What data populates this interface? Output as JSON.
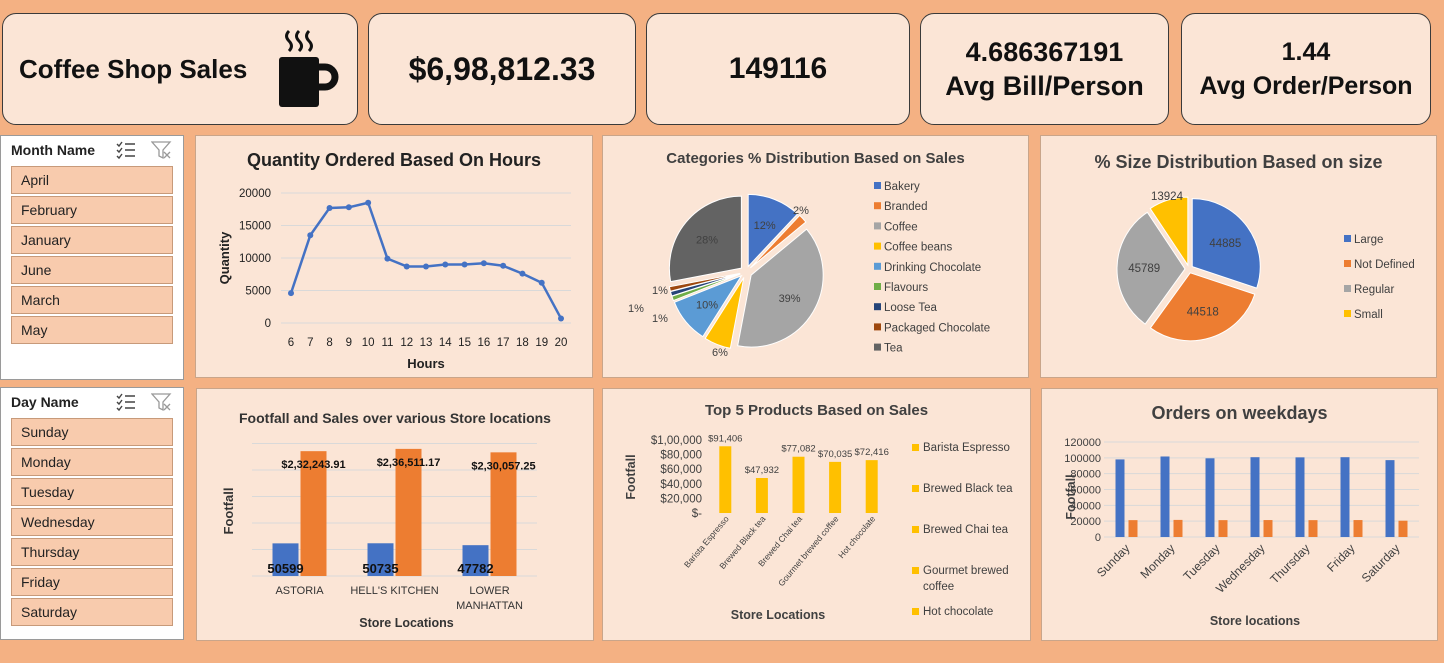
{
  "kpis": {
    "title": "Coffee Shop Sales",
    "total_sales": "$6,98,812.33",
    "total_orders": "149116",
    "avg_bill_value": "4.686367191",
    "avg_bill_label": "Avg Bill/Person",
    "avg_order_value": "1.44",
    "avg_order_label": "Avg Order/Person"
  },
  "slicers": {
    "month": {
      "header": "Month Name",
      "items": [
        "April",
        "February",
        "January",
        "June",
        "March",
        "May"
      ]
    },
    "day": {
      "header": "Day Name",
      "items": [
        "Sunday",
        "Monday",
        "Tuesday",
        "Wednesday",
        "Thursday",
        "Friday",
        "Saturday"
      ]
    }
  },
  "colors": {
    "blue": "#4472c4",
    "orange": "#ed7d31",
    "gray": "#a5a5a5",
    "gold": "#ffc000",
    "lightblue": "#5b9bd5",
    "green": "#70ad47",
    "navy": "#264478",
    "brown": "#9e480e",
    "darkgray": "#636363",
    "panel": "#fbe5d6",
    "background": "#f4b183"
  },
  "chart_data": [
    {
      "id": "hours",
      "type": "line",
      "title": "Quantity Ordered Based On Hours",
      "xlabel": "Hours",
      "ylabel": "Quantity",
      "x": [
        6,
        7,
        8,
        9,
        10,
        11,
        12,
        13,
        14,
        15,
        16,
        17,
        18,
        19,
        20
      ],
      "values": [
        4600,
        13500,
        17700,
        17800,
        18500,
        9900,
        8700,
        8700,
        9000,
        9000,
        9200,
        8800,
        7600,
        6200,
        700
      ],
      "yticks": [
        "0",
        "5000",
        "10000",
        "15000",
        "20000"
      ],
      "ylim": [
        0,
        20000
      ],
      "grid": true
    },
    {
      "id": "categories",
      "type": "pie",
      "title": "Categories % Distribution Based on Sales",
      "labels": [
        "Bakery",
        "Branded",
        "Coffee",
        "Coffee beans",
        "Drinking Chocolate",
        "Flavours",
        "Loose Tea",
        "Packaged Chocolate",
        "Tea"
      ],
      "values": [
        12,
        2,
        39,
        6,
        10,
        1,
        1,
        1,
        28
      ],
      "value_labels": [
        "12%",
        "2%",
        "39%",
        "6%",
        "10%",
        "1%",
        "1%",
        "1%",
        "28%"
      ],
      "legend": "right"
    },
    {
      "id": "sizes",
      "type": "pie",
      "title": "% Size Distribution Based on size",
      "labels": [
        "Large",
        "Not Defined",
        "Regular",
        "Small"
      ],
      "values": [
        44885,
        44518,
        45789,
        13924
      ],
      "value_labels": [
        "44885",
        "44518",
        "45789",
        "13924"
      ],
      "legend": "right"
    },
    {
      "id": "locations",
      "type": "bar",
      "title": "Footfall and Sales over various Store locations",
      "xlabel": "Store Locations",
      "ylabel": "Footfall",
      "categories": [
        "ASTORIA",
        "HELL'S KITCHEN",
        "LOWER MANHATTAN"
      ],
      "series": [
        {
          "values": [
            50599,
            50735,
            47782
          ],
          "labels": [
            "50599",
            "50735",
            "47782"
          ]
        },
        {
          "values": [
            232243.91,
            236511.17,
            230057.25
          ],
          "labels": [
            "$2,32,243.91",
            "$2,36,511.17",
            "$2,30,057.25"
          ]
        }
      ],
      "grid": true
    },
    {
      "id": "products",
      "type": "bar",
      "title": "Top 5 Products Based on Sales",
      "xlabel": "Store Locations",
      "ylabel": "Footfall",
      "categories": [
        "Barista Espresso",
        "Brewed Black tea",
        "Brewed Chai tea",
        "Gourmet brewed coffee",
        "Hot chocolate"
      ],
      "values": [
        91406,
        47932,
        77082,
        70035,
        72416
      ],
      "value_labels": [
        "$91,406",
        "$47,932",
        "$77,082",
        "$70,035",
        "$72,416"
      ],
      "yticks": [
        "$-",
        "$20,000",
        "$40,000",
        "$60,000",
        "$80,000",
        "$1,00,000"
      ],
      "ylim": [
        0,
        100000
      ],
      "legend": [
        "Barista Espresso",
        "Brewed Black tea",
        "Brewed Chai tea",
        "Gourmet brewed coffee",
        "Hot chocolate"
      ],
      "legend_position": "right"
    },
    {
      "id": "weekdays",
      "type": "bar",
      "title": "Orders on weekdays",
      "xlabel": "Store locations",
      "ylabel": "Footfall",
      "categories": [
        "Sunday",
        "Monday",
        "Tuesday",
        "Wednesday",
        "Thursday",
        "Friday",
        "Saturday"
      ],
      "series": [
        {
          "values": [
            98000,
            101700,
            99400,
            100800,
            100600,
            100800,
            97100
          ]
        },
        {
          "values": [
            21300,
            21600,
            21300,
            21400,
            21300,
            21400,
            20600
          ]
        }
      ],
      "yticks": [
        "0",
        "20000",
        "40000",
        "60000",
        "80000",
        "100000",
        "120000"
      ],
      "ylim": [
        0,
        120000
      ],
      "grid": true
    }
  ]
}
